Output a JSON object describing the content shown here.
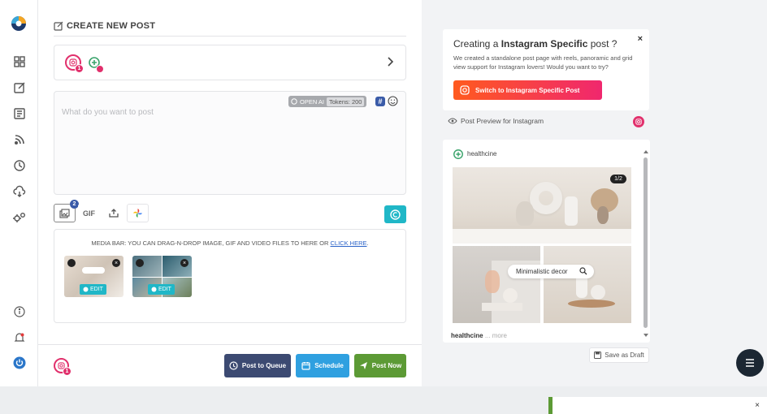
{
  "app": {
    "logo_icon": "circle-brand-logo-icon"
  },
  "sidebar": {
    "items": [
      {
        "icon": "dashboard-icon"
      },
      {
        "icon": "compose-icon"
      },
      {
        "icon": "document-icon"
      },
      {
        "icon": "rss-icon"
      },
      {
        "icon": "history-icon"
      },
      {
        "icon": "cloud-download-icon"
      },
      {
        "icon": "settings-icon"
      }
    ],
    "bottom": [
      {
        "icon": "info-icon"
      },
      {
        "icon": "bell-icon"
      },
      {
        "icon": "power-icon"
      }
    ]
  },
  "composer": {
    "title": "CREATE NEW POST",
    "accounts_badge": "1",
    "editor_placeholder": "What do you want to post",
    "openai_label": "OPEN AI",
    "tokens_label": "Tokens: 200",
    "tools": {
      "media_count": "2",
      "gif_label": "GIF"
    },
    "media_bar_text": "MEDIA BAR: YOU CAN DRAG-N-DROP IMAGE, GIF AND VIDEO FILES TO HERE OR ",
    "media_bar_link": "CLICK HERE",
    "media_bar_end": ".",
    "thumb_edit_label": "EDIT",
    "footer_account_badge": "1",
    "buttons": {
      "queue": "Post to Queue",
      "schedule": "Schedule",
      "now": "Post Now"
    }
  },
  "promo": {
    "title_prefix": "Creating a ",
    "title_bold": "Instagram Specific",
    "title_suffix": " post ?",
    "body": "We created a standalone post page with reels, panoramic and grid view support for Instagram lovers! Would you want to try?",
    "button": "Switch to Instagram Specific Post",
    "close": "×"
  },
  "preview": {
    "label": "Post Preview for Instagram",
    "username": "healthcine",
    "counter": "1/2",
    "search_text": "Minimalistic decor",
    "caption_user": "healthcine",
    "caption_more": "... more",
    "save_draft": "Save as Draft"
  },
  "toast": {
    "close": "×"
  },
  "colors": {
    "instagram": "#e1306c",
    "queue": "#3c4a72",
    "schedule": "#2fa0e0",
    "post_now": "#5c9a35",
    "canva": "#20b7c7"
  }
}
